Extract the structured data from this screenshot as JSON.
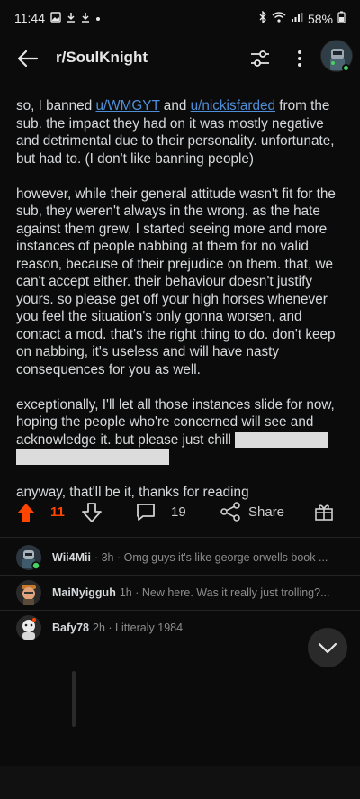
{
  "status_bar": {
    "time": "11:44",
    "battery": "58%"
  },
  "header": {
    "subreddit": "r/SoulKnight"
  },
  "post": {
    "p1_pre": "so, I banned ",
    "user1": "u/WMGYT",
    "p1_and": " and ",
    "user2": "u/nickisfarded",
    "p1_post": " from the sub. the impact they had on it was mostly negative and detrimental due to their personality. unfortunate, but had to. (I don't like banning people)",
    "p2": "however, while their general attitude wasn't fit for the sub, they weren't always in the wrong. as the hate against them grew, I started seeing more and more instances of people nabbing at them for no valid reason, because of their prejudice on them. that, we can't accept either. their behaviour doesn't justify yours. so please get off your high horses whenever you feel the situation's only gonna worsen, and contact a mod. that's the right thing to do. don't keep on nabbing, it's useless and will have nasty consequences for you as well.",
    "p3": "exceptionally, I'll let all those instances slide for now, hoping the people who're concerned will see and acknowledge it. but please just chill",
    "p4": "anyway, that'll be it, thanks for reading"
  },
  "actions": {
    "upvotes": "11",
    "comments": "19",
    "share_label": "Share"
  },
  "comments": [
    {
      "user": "Wii4Mii",
      "meta": "· 3h · Omg guys it's like george orwells book ..."
    },
    {
      "user": "MaiNyigguh",
      "meta": "1h · New here. Was it really just trolling?..."
    },
    {
      "user": "Bafy78",
      "meta": "2h · Litteraly 1984"
    }
  ],
  "colors": {
    "background": "#0b0b0b",
    "upvote_accent": "#ff4500",
    "link": "#4f8fd8",
    "online": "#46d160"
  },
  "icons": [
    "back-arrow-icon",
    "filter-icon",
    "more-vertical-icon",
    "upvote-icon",
    "downvote-icon",
    "comment-icon",
    "share-icon",
    "award-icon",
    "chevron-down-icon"
  ]
}
